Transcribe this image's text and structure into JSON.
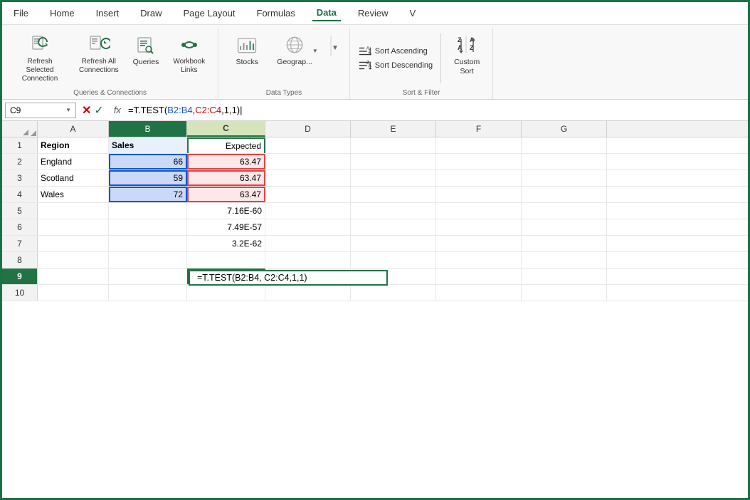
{
  "menu": {
    "items": [
      "File",
      "Home",
      "Insert",
      "Draw",
      "Page Layout",
      "Formulas",
      "Data",
      "Review",
      "V"
    ],
    "active": "Data"
  },
  "ribbon": {
    "groups": [
      {
        "label": "Queries & Connections",
        "buttons": [
          {
            "id": "refresh-selected",
            "label": "Refresh Selected\nConnection",
            "icon": "refresh-selected-icon"
          },
          {
            "id": "refresh-all",
            "label": "Refresh All\nConnections",
            "icon": "refresh-all-icon"
          },
          {
            "id": "queries",
            "label": "Queries",
            "icon": "queries-icon"
          },
          {
            "id": "workbook-links",
            "label": "Workbook\nLinks",
            "icon": "workbook-links-icon"
          }
        ]
      },
      {
        "label": "Data Types",
        "buttons": [
          {
            "id": "stocks",
            "label": "Stocks",
            "icon": "stocks-icon"
          },
          {
            "id": "geography",
            "label": "Geograp...",
            "icon": "geography-icon"
          }
        ]
      },
      {
        "label": "Sort & Filter",
        "items": [
          {
            "id": "sort-ascending",
            "label": "Sort Ascending"
          },
          {
            "id": "sort-descending",
            "label": "Sort Descending"
          }
        ],
        "custom_label": "Custom\nSort"
      }
    ]
  },
  "formula_bar": {
    "cell_ref": "C9",
    "formula": "=T.TEST(B2:B4, C2:C4,1,1)",
    "formula_parts": [
      {
        "text": "=T.TEST(",
        "color": "black"
      },
      {
        "text": "B2:B4",
        "color": "#1155cc"
      },
      {
        "text": ", ",
        "color": "black"
      },
      {
        "text": "C2:C4",
        "color": "#cc0000"
      },
      {
        "text": ",1,1)",
        "color": "black"
      }
    ]
  },
  "grid": {
    "columns": [
      "A",
      "B",
      "C",
      "D",
      "E",
      "F",
      "G"
    ],
    "active_col": "C",
    "active_row": 9,
    "selected_b_rows": [
      2,
      3,
      4
    ],
    "selected_c_rows": [
      2,
      3,
      4
    ],
    "rows": [
      {
        "row": 1,
        "cells": [
          {
            "col": "A",
            "value": "Region",
            "bold": true
          },
          {
            "col": "B",
            "value": "Sales",
            "bold": true
          },
          {
            "col": "C",
            "value": "Expected",
            "align": "right"
          },
          {
            "col": "D",
            "value": ""
          },
          {
            "col": "E",
            "value": ""
          },
          {
            "col": "F",
            "value": ""
          },
          {
            "col": "G",
            "value": ""
          }
        ]
      },
      {
        "row": 2,
        "cells": [
          {
            "col": "A",
            "value": "England"
          },
          {
            "col": "B",
            "value": "66",
            "align": "right",
            "selected_b": true
          },
          {
            "col": "C",
            "value": "63.47",
            "align": "right",
            "selected_c": true
          },
          {
            "col": "D",
            "value": ""
          },
          {
            "col": "E",
            "value": ""
          },
          {
            "col": "F",
            "value": ""
          },
          {
            "col": "G",
            "value": ""
          }
        ]
      },
      {
        "row": 3,
        "cells": [
          {
            "col": "A",
            "value": "Scotland"
          },
          {
            "col": "B",
            "value": "59",
            "align": "right",
            "selected_b": true
          },
          {
            "col": "C",
            "value": "63.47",
            "align": "right",
            "selected_c": true
          },
          {
            "col": "D",
            "value": ""
          },
          {
            "col": "E",
            "value": ""
          },
          {
            "col": "F",
            "value": ""
          },
          {
            "col": "G",
            "value": ""
          }
        ]
      },
      {
        "row": 4,
        "cells": [
          {
            "col": "A",
            "value": "Wales"
          },
          {
            "col": "B",
            "value": "72",
            "align": "right",
            "selected_b": true
          },
          {
            "col": "C",
            "value": "63.47",
            "align": "right",
            "selected_c": true
          },
          {
            "col": "D",
            "value": ""
          },
          {
            "col": "E",
            "value": ""
          },
          {
            "col": "F",
            "value": ""
          },
          {
            "col": "G",
            "value": ""
          }
        ]
      },
      {
        "row": 5,
        "cells": [
          {
            "col": "A",
            "value": ""
          },
          {
            "col": "B",
            "value": ""
          },
          {
            "col": "C",
            "value": "7.16E-60",
            "align": "right"
          },
          {
            "col": "D",
            "value": ""
          },
          {
            "col": "E",
            "value": ""
          },
          {
            "col": "F",
            "value": ""
          },
          {
            "col": "G",
            "value": ""
          }
        ]
      },
      {
        "row": 6,
        "cells": [
          {
            "col": "A",
            "value": ""
          },
          {
            "col": "B",
            "value": ""
          },
          {
            "col": "C",
            "value": "7.49E-57",
            "align": "right"
          },
          {
            "col": "D",
            "value": ""
          },
          {
            "col": "E",
            "value": ""
          },
          {
            "col": "F",
            "value": ""
          },
          {
            "col": "G",
            "value": ""
          }
        ]
      },
      {
        "row": 7,
        "cells": [
          {
            "col": "A",
            "value": ""
          },
          {
            "col": "B",
            "value": ""
          },
          {
            "col": "C",
            "value": "3.2E-62",
            "align": "right"
          },
          {
            "col": "D",
            "value": ""
          },
          {
            "col": "E",
            "value": ""
          },
          {
            "col": "F",
            "value": ""
          },
          {
            "col": "G",
            "value": ""
          }
        ]
      },
      {
        "row": 8,
        "cells": [
          {
            "col": "A",
            "value": ""
          },
          {
            "col": "B",
            "value": ""
          },
          {
            "col": "C",
            "value": ""
          },
          {
            "col": "D",
            "value": ""
          },
          {
            "col": "E",
            "value": ""
          },
          {
            "col": "F",
            "value": ""
          },
          {
            "col": "G",
            "value": ""
          }
        ]
      },
      {
        "row": 9,
        "cells": [
          {
            "col": "A",
            "value": ""
          },
          {
            "col": "B",
            "value": ""
          },
          {
            "col": "C",
            "value": "=T.TEST(B2:B4, C2:C4,1,1)",
            "align": "right",
            "active": true,
            "tooltip": "=T.TEST(B2:B4, C2:C4,1,1)"
          },
          {
            "col": "D",
            "value": ""
          },
          {
            "col": "E",
            "value": ""
          },
          {
            "col": "F",
            "value": ""
          },
          {
            "col": "G",
            "value": ""
          }
        ]
      },
      {
        "row": 10,
        "cells": [
          {
            "col": "A",
            "value": ""
          },
          {
            "col": "B",
            "value": ""
          },
          {
            "col": "C",
            "value": ""
          },
          {
            "col": "D",
            "value": ""
          },
          {
            "col": "E",
            "value": ""
          },
          {
            "col": "F",
            "value": ""
          },
          {
            "col": "G",
            "value": ""
          }
        ]
      }
    ]
  },
  "labels": {
    "refresh_selected": "Refresh Selected\nConnection",
    "refresh_all": "Refresh All\nConnections",
    "queries": "Queries",
    "workbook_links": "Workbook\nLinks",
    "stocks": "Stocks",
    "geography": "Geograp...",
    "queries_connections_group": "Queries & Connections",
    "data_types_group": "Data Types",
    "sort_filter_group": "Sort & Filter",
    "sort_ascending": "Sort Ascending",
    "sort_descending": "Sort Descending",
    "custom_sort": "Custom\nSort",
    "sort_label": "Sort",
    "formula_bar_fx": "fx"
  }
}
